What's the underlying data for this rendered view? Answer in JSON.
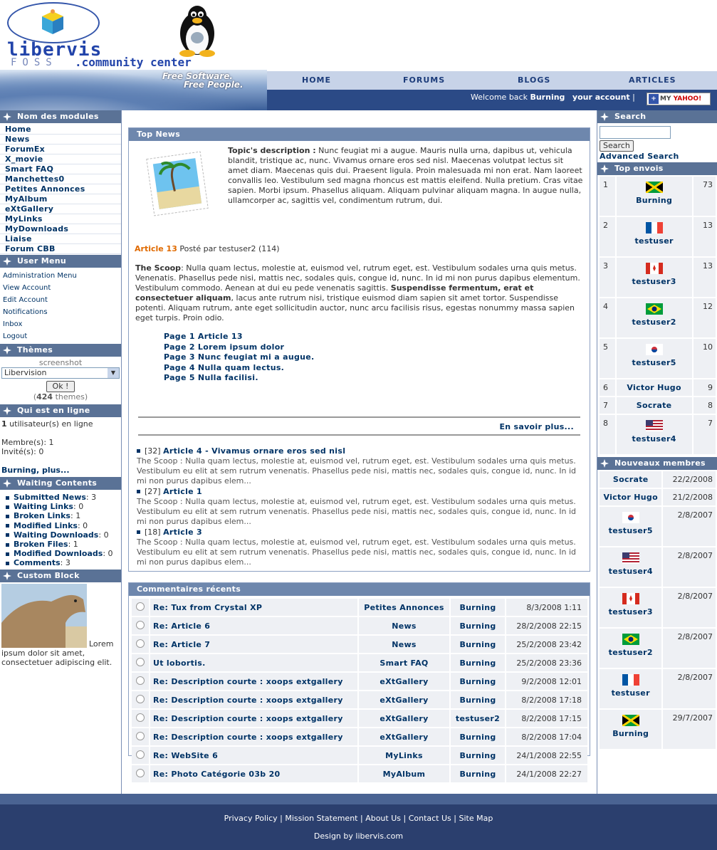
{
  "header": {
    "logo_main": "libervis",
    "logo_foss": "FOSS",
    "logo_cc": ".community center",
    "slogan1": "Free Software.",
    "slogan2": "Free People.",
    "nav": [
      "HOME",
      "FORUMS",
      "BLOGS",
      "ARTICLES"
    ],
    "welcome_prefix": "Welcome back",
    "welcome_user": "Burning",
    "your_account": "your account",
    "yahoo_label": "MY",
    "yahoo_brand": "YAHOO!"
  },
  "left": {
    "modules_title": "Nom des modules",
    "modules": [
      "Home",
      "News",
      "ForumEx",
      "X_movie",
      "Smart FAQ",
      "Manchettes0",
      "Petites Annonces",
      "MyAlbum",
      "eXtGallery",
      "MyLinks",
      "MyDownloads",
      "Liaise",
      "Forum CBB"
    ],
    "usermenu_title": "User Menu",
    "usermenu": [
      "Administration Menu",
      "View Account",
      "Edit Account",
      "Notifications",
      "Inbox",
      "Logout"
    ],
    "themes_title": "Thèmes",
    "themes_screenshot": "screenshot",
    "theme_selected": "Libervision",
    "themes_ok": "Ok !",
    "themes_count": "424",
    "themes_count_label": "themes",
    "online_title": "Qui est en ligne",
    "online_count": "1",
    "online_text": "utilisateur(s) en ligne",
    "members": "Membre(s): 1",
    "guests": "Invité(s): 0",
    "online_more": "Burning, plus...",
    "waiting_title": "Waiting Contents",
    "waiting": [
      {
        "label": "Submitted News",
        "value": "3"
      },
      {
        "label": "Waiting Links",
        "value": "0"
      },
      {
        "label": "Broken Links",
        "value": "1"
      },
      {
        "label": "Modified Links",
        "value": "0"
      },
      {
        "label": "Waiting Downloads",
        "value": "0"
      },
      {
        "label": "Broken Files",
        "value": "1"
      },
      {
        "label": "Modified Downloads",
        "value": "0"
      },
      {
        "label": "Comments",
        "value": "3"
      }
    ],
    "custom_title": "Custom Block",
    "custom_text": "Lorem ipsum dolor sit amet, consectetuer adipiscing elit."
  },
  "center": {
    "topnews_title": "Top News",
    "topic_label": "Topic's description :",
    "topic_text": "Nunc feugiat mi a augue. Mauris nulla urna, dapibus ut, vehicula blandit, tristique ac, nunc. Vivamus ornare eros sed nisl. Maecenas volutpat lectus sit amet diam. Maecenas quis dui. Praesent ligula. Proin malesuada mi non erat. Nam laoreet convallis leo. Vestibulum sed magna rhoncus est mattis eleifend. Nulla pretium. Cras vitae sapien. Morbi ipsum. Phasellus aliquam. Aliquam pulvinar aliquam magna. In augue nulla, ullamcorper ac, sagittis vel, condimentum rutrum, dui.",
    "article_title": "Article 13",
    "article_meta": "Posté par testuser2 (114)",
    "scoop_label": "The Scoop",
    "scoop_text1": ": Nulla quam lectus, molestie at, euismod vel, rutrum eget, est. Vestibulum sodales urna quis metus. Venenatis. Phasellus pede nisi, mattis nec, sodales quis, congue id, nunc. In id mi non purus dapibus elementum. Vestibulum commodo. Aenean at dui eu pede venenatis sagittis.",
    "scoop_bold": "Suspendisse fermentum, erat et consectetuer aliquam",
    "scoop_text2": ", lacus ante rutrum nisi, tristique euismod diam sapien sit amet tortor. Suspendisse potenti. Aliquam rutrum, ante eget sollicitudin auctor, nunc arcu facilisis risus, egestas nonummy massa sapien eget turpis. Proin odio.",
    "pages": [
      "Page 1 Article 13",
      "Page 2 Lorem ipsum dolor",
      "Page 3 Nunc feugiat mi a augue.",
      "Page 4 Nulla quam lectus.",
      "Page 5 Nulla facilisi."
    ],
    "read_more": "En savoir plus...",
    "news": [
      {
        "count": "[32]",
        "title": "Article 4 - Vivamus ornare eros sed nisl",
        "text": "The Scoop : Nulla quam lectus, molestie at, euismod vel, rutrum eget, est. Vestibulum sodales urna quis metus. Vestibulum eu elit at sem rutrum venenatis. Phasellus pede nisi, mattis nec, sodales quis, congue id, nunc. In id mi non purus dapibus elem..."
      },
      {
        "count": "[27]",
        "title": "Article 1",
        "text": "The Scoop : Nulla quam lectus, molestie at, euismod vel, rutrum eget, est. Vestibulum sodales urna quis metus. Vestibulum eu elit at sem rutrum venenatis. Phasellus pede nisi, mattis nec, sodales quis, congue id, nunc. In id mi non purus dapibus elem..."
      },
      {
        "count": "[18]",
        "title": "Article 3",
        "text": "The Scoop : Nulla quam lectus, molestie at, euismod vel, rutrum eget, est. Vestibulum sodales urna quis metus. Vestibulum eu elit at sem rutrum venenatis. Phasellus pede nisi, mattis nec, sodales quis, congue id, nunc. In id mi non purus dapibus elem..."
      }
    ],
    "comments_title": "Commentaires récents",
    "comments": [
      {
        "title": "Re: Tux from Crystal XP",
        "module": "Petites Annonces",
        "user": "Burning",
        "date": "8/3/2008 1:11"
      },
      {
        "title": "Re: Article 6",
        "module": "News",
        "user": "Burning",
        "date": "28/2/2008 22:15"
      },
      {
        "title": "Re: Article 7",
        "module": "News",
        "user": "Burning",
        "date": "25/2/2008 23:42"
      },
      {
        "title": "Ut lobortis.",
        "module": "Smart FAQ",
        "user": "Burning",
        "date": "25/2/2008 23:36"
      },
      {
        "title": "Re: Description courte : xoops extgallery",
        "module": "eXtGallery",
        "user": "Burning",
        "date": "9/2/2008 12:01"
      },
      {
        "title": "Re: Description courte : xoops extgallery",
        "module": "eXtGallery",
        "user": "Burning",
        "date": "8/2/2008 17:18"
      },
      {
        "title": "Re: Description courte : xoops extgallery",
        "module": "eXtGallery",
        "user": "testuser2",
        "date": "8/2/2008 17:15"
      },
      {
        "title": "Re: Description courte : xoops extgallery",
        "module": "eXtGallery",
        "user": "Burning",
        "date": "8/2/2008 17:04"
      },
      {
        "title": "Re: WebSite 6",
        "module": "MyLinks",
        "user": "Burning",
        "date": "24/1/2008 22:55"
      },
      {
        "title": "Re: Photo Catégorie 03b 20",
        "module": "MyAlbum",
        "user": "Burning",
        "date": "24/1/2008 22:27"
      }
    ]
  },
  "right": {
    "search_title": "Search",
    "search_button": "Search",
    "advanced_search": "Advanced Search",
    "topenvois_title": "Top envois",
    "topenvois": [
      {
        "rank": "1",
        "user": "Burning",
        "count": "73",
        "flag": "jamaica"
      },
      {
        "rank": "2",
        "user": "testuser",
        "count": "13",
        "flag": "france"
      },
      {
        "rank": "3",
        "user": "testuser3",
        "count": "13",
        "flag": "canada"
      },
      {
        "rank": "4",
        "user": "testuser2",
        "count": "12",
        "flag": "brazil"
      },
      {
        "rank": "5",
        "user": "testuser5",
        "count": "10",
        "flag": "korea"
      },
      {
        "rank": "6",
        "user": "Victor Hugo",
        "count": "9",
        "flag": ""
      },
      {
        "rank": "7",
        "user": "Socrate",
        "count": "8",
        "flag": ""
      },
      {
        "rank": "8",
        "user": "testuser4",
        "count": "7",
        "flag": "usa"
      }
    ],
    "newmembers_title": "Nouveaux membres",
    "newmembers": [
      {
        "user": "Socrate",
        "date": "22/2/2008",
        "flag": ""
      },
      {
        "user": "Victor Hugo",
        "date": "21/2/2008",
        "flag": ""
      },
      {
        "user": "testuser5",
        "date": "2/8/2007",
        "flag": "korea"
      },
      {
        "user": "testuser4",
        "date": "2/8/2007",
        "flag": "usa"
      },
      {
        "user": "testuser3",
        "date": "2/8/2007",
        "flag": "canada"
      },
      {
        "user": "testuser2",
        "date": "2/8/2007",
        "flag": "brazil"
      },
      {
        "user": "testuser",
        "date": "2/8/2007",
        "flag": "france"
      },
      {
        "user": "Burning",
        "date": "29/7/2007",
        "flag": "jamaica"
      }
    ]
  },
  "footer": {
    "links": [
      "Privacy Policy",
      "Mission Statement",
      "About Us",
      "Contact Us",
      "Site Map"
    ],
    "design": "Design by libervis.com"
  }
}
